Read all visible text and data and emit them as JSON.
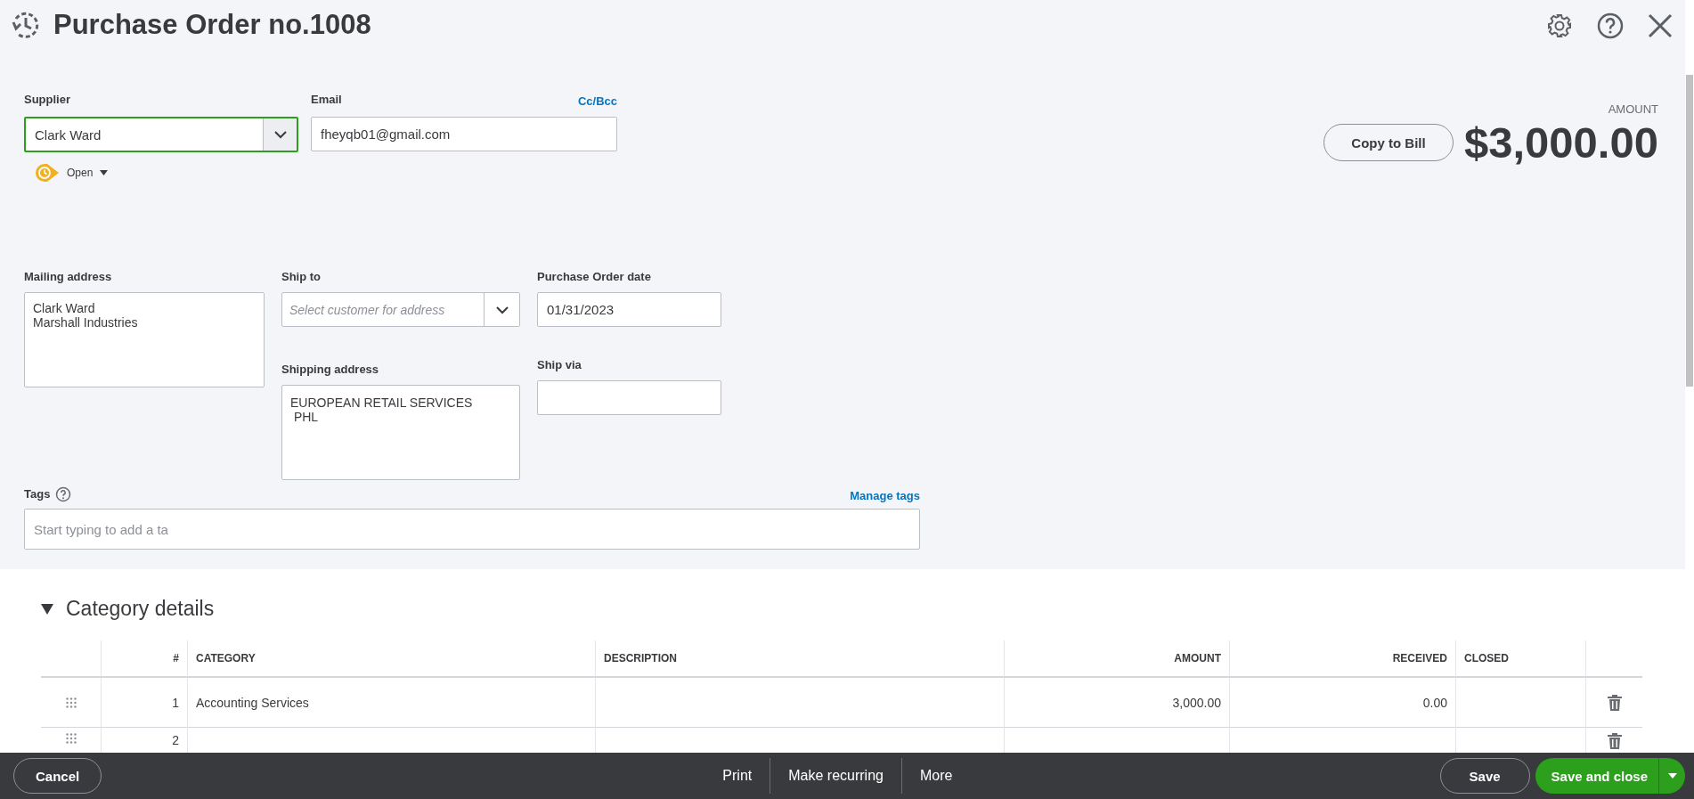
{
  "header": {
    "title": "Purchase Order no.1008"
  },
  "supplier": {
    "label": "Supplier",
    "value": "Clark Ward"
  },
  "email": {
    "label": "Email",
    "link": "Cc/Bcc",
    "value": "fheyqb01@gmail.com"
  },
  "status": {
    "label": "Open"
  },
  "amount": {
    "label": "AMOUNT",
    "value": "$3,000.00",
    "button": "Copy to Bill"
  },
  "mailing_address": {
    "label": "Mailing address",
    "value": "Clark Ward\nMarshall Industries"
  },
  "ship_to": {
    "label": "Ship to",
    "placeholder": "Select customer for address"
  },
  "shipping_address": {
    "label": "Shipping address",
    "value": "EUROPEAN RETAIL SERVICES\n PHL"
  },
  "purchase_order_date": {
    "label": "Purchase Order date",
    "value": "01/31/2023"
  },
  "ship_via": {
    "label": "Ship via"
  },
  "tags": {
    "label": "Tags",
    "link": "Manage tags",
    "placeholder": "Start typing to add a ta"
  },
  "category_details": {
    "title": "Category details",
    "expanded": true,
    "columns": [
      "#",
      "CATEGORY",
      "DESCRIPTION",
      "AMOUNT",
      "RECEIVED",
      "CLOSED"
    ],
    "rows": [
      {
        "number": "1",
        "category": "Accounting Services",
        "amount": "3,000.00",
        "received": "0.00"
      },
      {
        "number": "2"
      }
    ]
  },
  "footer": {
    "cancel": "Cancel",
    "actions": [
      "Print",
      "Make recurring",
      "More"
    ],
    "save": "Save",
    "save_and_close": "Save and close"
  }
}
